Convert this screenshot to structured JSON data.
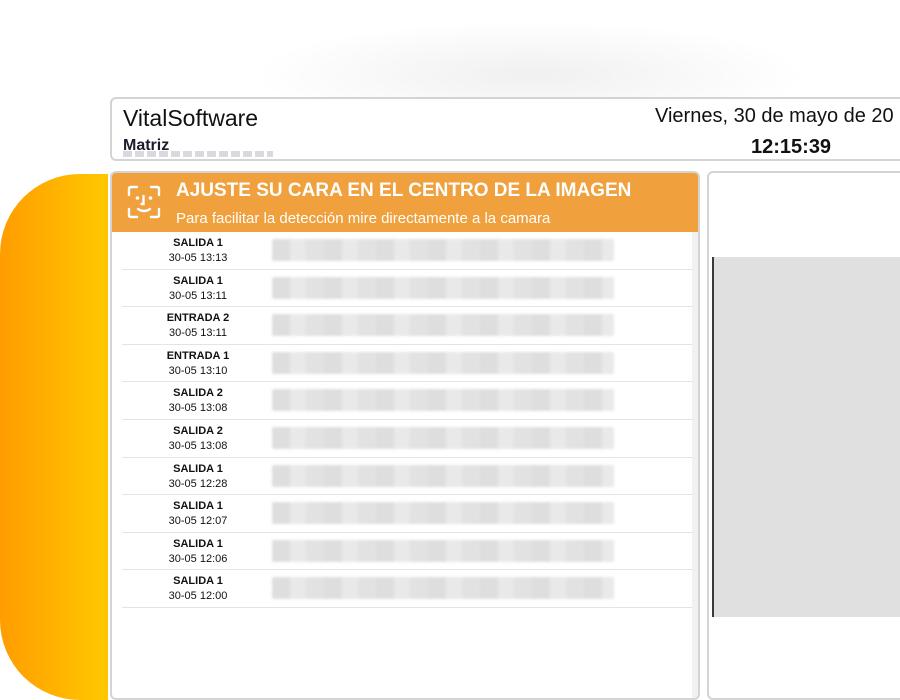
{
  "header": {
    "brand": "VitalSoftware",
    "location": "Matriz",
    "date": "Viernes, 30 de mayo de 20",
    "time": "12:15:39"
  },
  "banner": {
    "icon": "face-scan-icon",
    "title": "AJUSTE SU CARA EN EL CENTRO DE LA IMAGEN",
    "subtitle": "Para facilitar la detección mire directamente a la camara"
  },
  "records": [
    {
      "type": "SALIDA 1",
      "time": "30-05 13:13"
    },
    {
      "type": "SALIDA 1",
      "time": "30-05 13:11"
    },
    {
      "type": "ENTRADA 2",
      "time": "30-05 13:11"
    },
    {
      "type": "ENTRADA 1",
      "time": "30-05 13:10"
    },
    {
      "type": "SALIDA 2",
      "time": "30-05 13:08"
    },
    {
      "type": "SALIDA 2",
      "time": "30-05 13:08"
    },
    {
      "type": "SALIDA 1",
      "time": "30-05 12:28"
    },
    {
      "type": "SALIDA 1",
      "time": "30-05 12:07"
    },
    {
      "type": "SALIDA 1",
      "time": "30-05 12:06"
    },
    {
      "type": "SALIDA 1",
      "time": "30-05 12:00"
    }
  ],
  "colors": {
    "banner": "#f0a03c",
    "accent_gradient_start": "#ff9d00",
    "accent_gradient_end": "#ffc800",
    "camera_placeholder": "#e0e0e0"
  }
}
